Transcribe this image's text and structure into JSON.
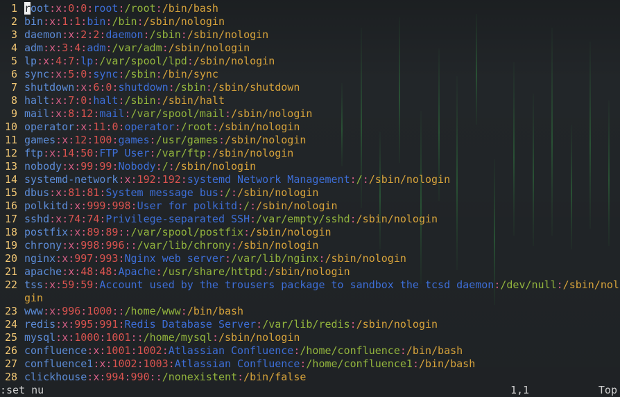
{
  "colors": {
    "user": "#5c8bd6",
    "separator": "#d75f87",
    "uid": "#d9534f",
    "gid": "#d9534f",
    "gecos": "#3d6ed7",
    "home": "#93b53d",
    "shell": "#d7a33b",
    "line_number": "#f0c674",
    "background": "#222629"
  },
  "editor": {
    "lines": [
      {
        "n": "1",
        "user": "root",
        "uid": "0",
        "gid": "0",
        "gecos": "root",
        "home": "/root",
        "shell": "/bin/bash"
      },
      {
        "n": "2",
        "user": "bin",
        "uid": "1",
        "gid": "1",
        "gecos": "bin",
        "home": "/bin",
        "shell": "/sbin/nologin"
      },
      {
        "n": "3",
        "user": "daemon",
        "uid": "2",
        "gid": "2",
        "gecos": "daemon",
        "home": "/sbin",
        "shell": "/sbin/nologin"
      },
      {
        "n": "4",
        "user": "adm",
        "uid": "3",
        "gid": "4",
        "gecos": "adm",
        "home": "/var/adm",
        "shell": "/sbin/nologin"
      },
      {
        "n": "5",
        "user": "lp",
        "uid": "4",
        "gid": "7",
        "gecos": "lp",
        "home": "/var/spool/lpd",
        "shell": "/sbin/nologin"
      },
      {
        "n": "6",
        "user": "sync",
        "uid": "5",
        "gid": "0",
        "gecos": "sync",
        "home": "/sbin",
        "shell": "/bin/sync"
      },
      {
        "n": "7",
        "user": "shutdown",
        "uid": "6",
        "gid": "0",
        "gecos": "shutdown",
        "home": "/sbin",
        "shell": "/sbin/shutdown"
      },
      {
        "n": "8",
        "user": "halt",
        "uid": "7",
        "gid": "0",
        "gecos": "halt",
        "home": "/sbin",
        "shell": "/sbin/halt"
      },
      {
        "n": "9",
        "user": "mail",
        "uid": "8",
        "gid": "12",
        "gecos": "mail",
        "home": "/var/spool/mail",
        "shell": "/sbin/nologin"
      },
      {
        "n": "10",
        "user": "operator",
        "uid": "11",
        "gid": "0",
        "gecos": "operator",
        "home": "/root",
        "shell": "/sbin/nologin"
      },
      {
        "n": "11",
        "user": "games",
        "uid": "12",
        "gid": "100",
        "gecos": "games",
        "home": "/usr/games",
        "shell": "/sbin/nologin"
      },
      {
        "n": "12",
        "user": "ftp",
        "uid": "14",
        "gid": "50",
        "gecos": "FTP User",
        "home": "/var/ftp",
        "shell": "/sbin/nologin"
      },
      {
        "n": "13",
        "user": "nobody",
        "uid": "99",
        "gid": "99",
        "gecos": "Nobody",
        "home": "/",
        "shell": "/sbin/nologin"
      },
      {
        "n": "14",
        "user": "systemd-network",
        "uid": "192",
        "gid": "192",
        "gecos": "systemd Network Management",
        "home": "/",
        "shell": "/sbin/nologin"
      },
      {
        "n": "15",
        "user": "dbus",
        "uid": "81",
        "gid": "81",
        "gecos": "System message bus",
        "home": "/",
        "shell": "/sbin/nologin"
      },
      {
        "n": "16",
        "user": "polkitd",
        "uid": "999",
        "gid": "998",
        "gecos": "User for polkitd",
        "home": "/",
        "shell": "/sbin/nologin"
      },
      {
        "n": "17",
        "user": "sshd",
        "uid": "74",
        "gid": "74",
        "gecos": "Privilege-separated SSH",
        "home": "/var/empty/sshd",
        "shell": "/sbin/nologin"
      },
      {
        "n": "18",
        "user": "postfix",
        "uid": "89",
        "gid": "89",
        "gecos": "",
        "home": "/var/spool/postfix",
        "shell": "/sbin/nologin"
      },
      {
        "n": "19",
        "user": "chrony",
        "uid": "998",
        "gid": "996",
        "gecos": "",
        "home": "/var/lib/chrony",
        "shell": "/sbin/nologin"
      },
      {
        "n": "20",
        "user": "nginx",
        "uid": "997",
        "gid": "993",
        "gecos": "Nginx web server",
        "home": "/var/lib/nginx",
        "shell": "/sbin/nologin"
      },
      {
        "n": "21",
        "user": "apache",
        "uid": "48",
        "gid": "48",
        "gecos": "Apache",
        "home": "/usr/share/httpd",
        "shell": "/sbin/nologin"
      },
      {
        "n": "22",
        "user": "tss",
        "uid": "59",
        "gid": "59",
        "gecos": "Account used by the trousers package to sandbox the tcsd daemon",
        "home": "/dev/null",
        "shell": "/sbin/nolo",
        "wrap": "gin"
      },
      {
        "n": "23",
        "user": "www",
        "uid": "996",
        "gid": "1000",
        "gecos": "",
        "home": "/home/www",
        "shell": "/bin/bash"
      },
      {
        "n": "24",
        "user": "redis",
        "uid": "995",
        "gid": "991",
        "gecos": "Redis Database Server",
        "home": "/var/lib/redis",
        "shell": "/sbin/nologin"
      },
      {
        "n": "25",
        "user": "mysql",
        "uid": "1000",
        "gid": "1001",
        "gecos": "",
        "home": "/home/mysql",
        "shell": "/sbin/nologin"
      },
      {
        "n": "26",
        "user": "confluence",
        "uid": "1001",
        "gid": "1002",
        "gecos": "Atlassian Confluence",
        "home": "/home/confluence",
        "shell": "/bin/bash"
      },
      {
        "n": "27",
        "user": "confluence1",
        "uid": "1002",
        "gid": "1003",
        "gecos": "Atlassian Confluence",
        "home": "/home/confluence1",
        "shell": "/bin/bash"
      },
      {
        "n": "28",
        "user": "clickhouse",
        "uid": "994",
        "gid": "990",
        "gecos": "",
        "home": "/nonexistent",
        "shell": "/bin/false"
      }
    ]
  },
  "status": {
    "command": ":set nu",
    "position": "1,1",
    "scroll": "Top"
  }
}
